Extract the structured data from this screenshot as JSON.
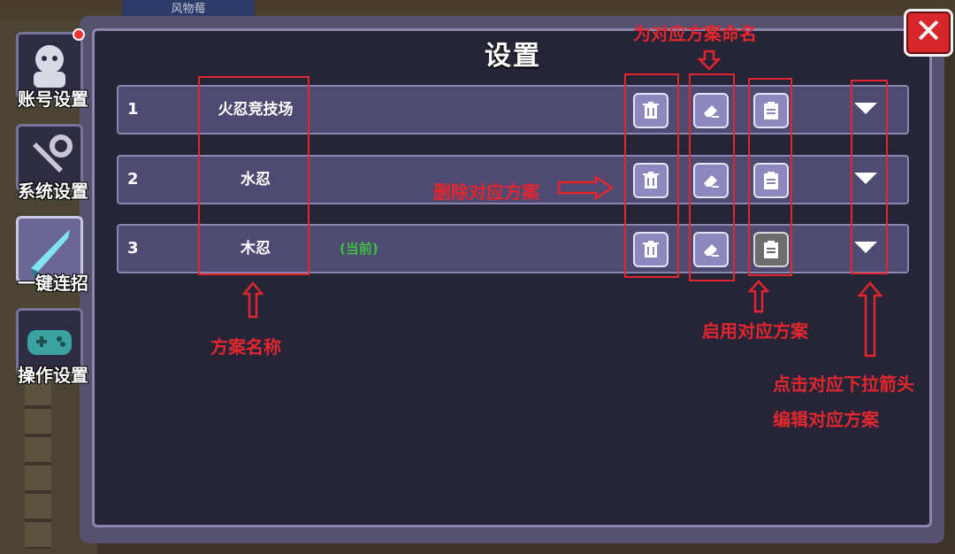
{
  "panel": {
    "title": "设置",
    "close_label": "✕"
  },
  "background": {
    "top_tab": "风物莓"
  },
  "sidebar": {
    "items": [
      {
        "label": "账号设置",
        "icon": "avatar-icon"
      },
      {
        "label": "系统设置",
        "icon": "wrench-icon"
      },
      {
        "label": "一键连招",
        "icon": "sword-icon"
      },
      {
        "label": "操作设置",
        "icon": "gamepad-icon"
      }
    ]
  },
  "schemes": [
    {
      "index": "1",
      "name": "火忍竞技场",
      "current": ""
    },
    {
      "index": "2",
      "name": "水忍",
      "current": ""
    },
    {
      "index": "3",
      "name": "木忍",
      "current": "(当前)"
    }
  ],
  "annotations": {
    "rename": "为对应方案命名",
    "delete": "删除对应方案",
    "scheme_name": "方案名称",
    "enable": "启用对应方案",
    "dropdown_line1": "点击对应下拉箭头",
    "dropdown_line2": "编辑对应方案"
  },
  "colors": {
    "annotation": "#e2262e",
    "current": "#3fbf3f",
    "close": "#d8262b"
  }
}
